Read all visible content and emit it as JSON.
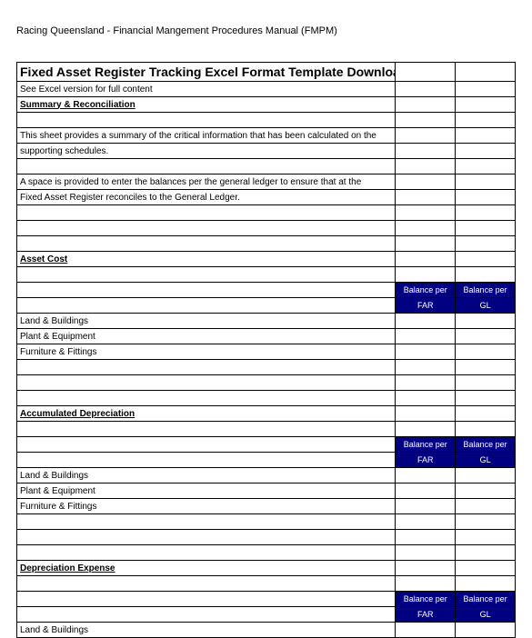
{
  "header": "Racing Queensland - Financial Mangement Procedures Manual (FMPM)",
  "title": "Fixed Asset Register Tracking Excel Format Template Download",
  "subtitle": "See Excel version for full content",
  "sections": {
    "summary": "Summary & Reconciliation",
    "assetCost": "Asset Cost",
    "accDep": "Accumulated Depreciation",
    "depExpense": "Depreciation Expense"
  },
  "desc": {
    "line1": "This sheet provides a summary of the critical information that has been calculated on the",
    "line2": "supporting schedules.",
    "line3": "A space is provided to enter the balances per the general ledger to ensure that at the",
    "line4": "Fixed Asset Register reconciles to the General Ledger."
  },
  "balanceHeader": {
    "line1col1": "Balance per",
    "line1col2": "Balance per",
    "line2col1": "FAR",
    "line2col2": "GL"
  },
  "items": {
    "landBuildings": "Land & Buildings",
    "plantEquipment": "Plant & Equipment",
    "furnitureFittings": "Furniture & Fittings"
  }
}
